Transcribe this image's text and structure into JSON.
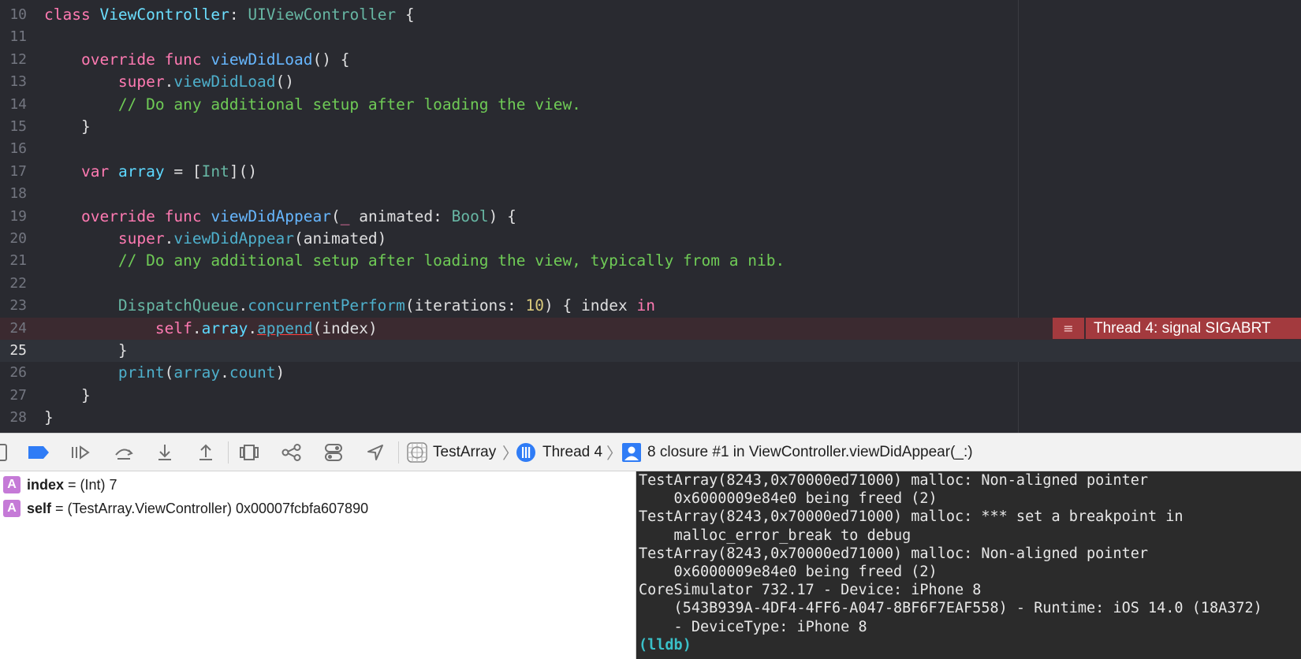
{
  "editor": {
    "line_numbers": [
      "10",
      "11",
      "12",
      "13",
      "14",
      "15",
      "16",
      "17",
      "18",
      "19",
      "20",
      "21",
      "22",
      "23",
      "24",
      "25",
      "26",
      "27",
      "28"
    ],
    "tokens": {
      "class_kw": "class",
      "class_name": "ViewController",
      "colon": ":",
      "superclass": "UIViewController",
      "brace_open": "{",
      "brace_close": "}",
      "override": "override",
      "func": "func",
      "viewDidLoad": "viewDidLoad",
      "parens": "()",
      "super": "super",
      "dot": ".",
      "comment1": "// Do any additional setup after loading the view.",
      "var": "var",
      "array": "array",
      "equals": "=",
      "int_open": "[",
      "int": "Int",
      "int_close": "]()",
      "viewDidAppear": "viewDidAppear",
      "paren_open": "(",
      "underscore": "_",
      "animated_param": "animated:",
      "bool": "Bool",
      "paren_close": ")",
      "animated": "animated",
      "comment2": "// Do any additional setup after loading the view, typically from a nib.",
      "dispatch": "DispatchQueue",
      "concurrent": "concurrentPerform",
      "iterations": "iterations:",
      "ten": "10",
      "index": "index",
      "in": "in",
      "self": "self",
      "append": "append",
      "print": "print",
      "count": "count"
    },
    "error_message": "Thread 4: signal SIGABRT",
    "error_icon": "hamburger-icon"
  },
  "toolbar": {
    "icons": [
      "hide-debug-area-icon",
      "breakpoints-active-icon",
      "continue-icon",
      "step-over-icon",
      "step-into-icon",
      "step-out-icon",
      "view-hierarchy-icon",
      "memory-graph-icon",
      "environment-overrides-icon",
      "simulate-location-icon"
    ],
    "crumb_target": "TestArray",
    "crumb_thread": "Thread 4",
    "crumb_frame": "8 closure #1 in ViewController.viewDidAppear(_:)"
  },
  "variables": [
    {
      "badge": "A",
      "name": "index",
      "type": " = (Int) ",
      "value": "7"
    },
    {
      "badge": "A",
      "name": "self",
      "type": " = (TestArray.ViewController) ",
      "value": "0x00007fcbfa607890"
    }
  ],
  "console": {
    "lines": [
      "TestArray(8243,0x70000ed71000) malloc: Non-aligned pointer",
      "    0x6000009e84e0 being freed (2)",
      "TestArray(8243,0x70000ed71000) malloc: *** set a breakpoint in",
      "    malloc_error_break to debug",
      "TestArray(8243,0x70000ed71000) malloc: Non-aligned pointer",
      "    0x6000009e84e0 being freed (2)",
      "CoreSimulator 732.17 - Device: iPhone 8",
      "    (543B939A-4DF4-4FF6-A047-8BF6F7EAF558) - Runtime: iOS 14.0 (18A372)",
      "    - DeviceType: iPhone 8"
    ],
    "prompt": "(lldb)"
  },
  "colors": {
    "editor_bg": "#292a30",
    "keyword": "#ff7ab2",
    "comment": "#6fcb56",
    "error_badge": "#a33a3e",
    "console_bg": "#2b2b2b",
    "variable_badge": "#c57ad7"
  }
}
